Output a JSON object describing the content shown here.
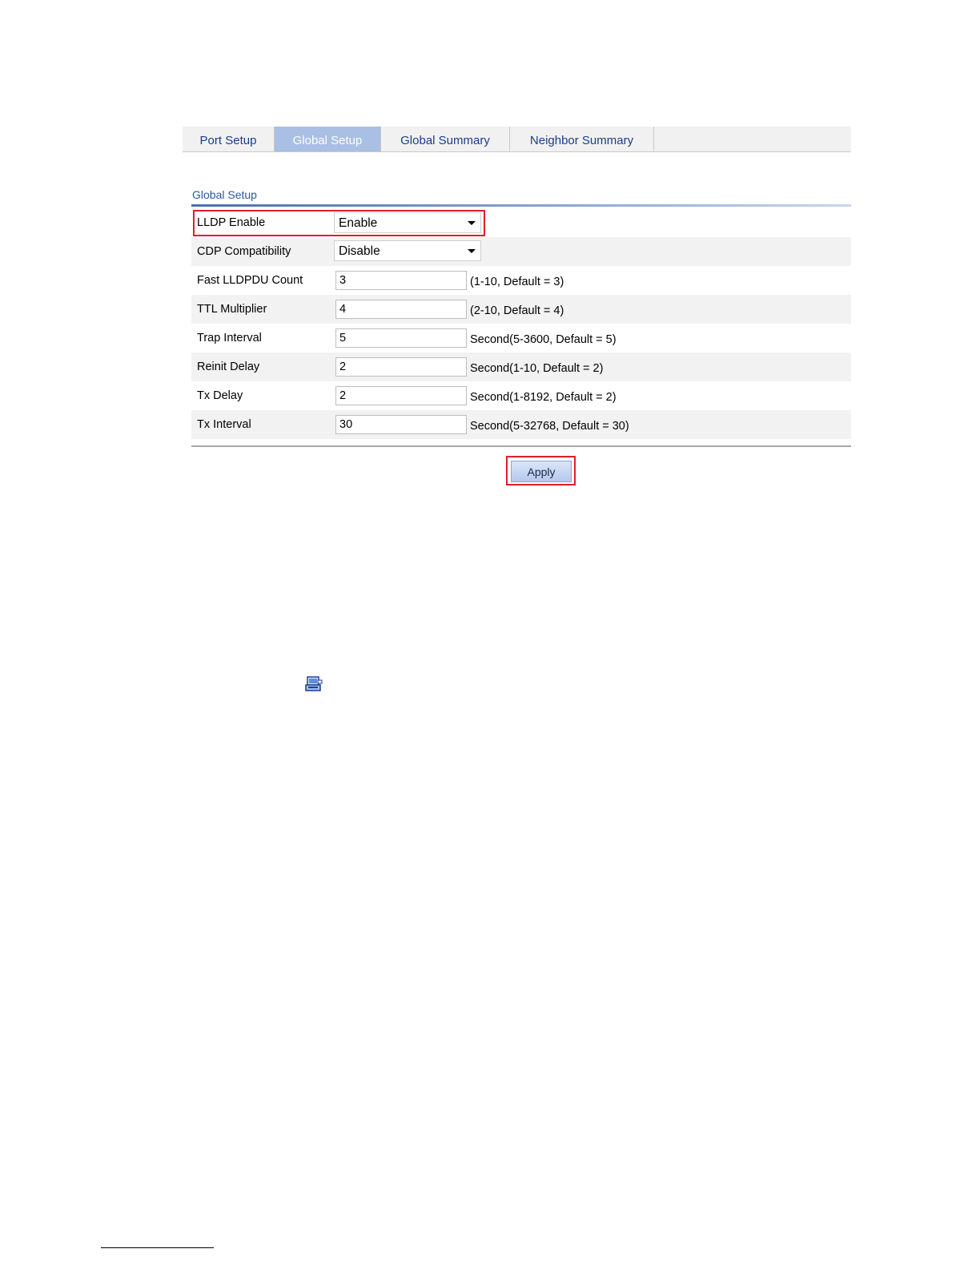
{
  "tabs": [
    {
      "label": "Port Setup",
      "active": false
    },
    {
      "label": "Global Setup",
      "active": true
    },
    {
      "label": "Global Summary",
      "active": false
    },
    {
      "label": "Neighbor Summary",
      "active": false
    }
  ],
  "section": {
    "title": "Global Setup"
  },
  "fields": {
    "lldp_enable": {
      "label": "LLDP Enable",
      "value": "Enable"
    },
    "cdp_compatibility": {
      "label": "CDP Compatibility",
      "value": "Disable"
    },
    "fast_lldpdu_count": {
      "label": "Fast LLDPDU Count",
      "value": "3",
      "hint": "(1-10, Default = 3)"
    },
    "ttl_multiplier": {
      "label": "TTL Multiplier",
      "value": "4",
      "hint": "(2-10, Default = 4)"
    },
    "trap_interval": {
      "label": "Trap Interval",
      "value": "5",
      "hint": "Second(5-3600, Default = 5)"
    },
    "reinit_delay": {
      "label": "Reinit Delay",
      "value": "2",
      "hint": "Second(1-10, Default = 2)"
    },
    "tx_delay": {
      "label": "Tx Delay",
      "value": "2",
      "hint": "Second(1-8192, Default = 2)"
    },
    "tx_interval": {
      "label": "Tx Interval",
      "value": "30",
      "hint": "Second(5-32768, Default = 30)"
    }
  },
  "apply_label": "Apply",
  "icons": {
    "inline_icon": "computer-config-icon"
  },
  "colors": {
    "accent": "#2a57a6",
    "highlight": "#e01e2b",
    "active_tab": "#a9bfe3"
  }
}
